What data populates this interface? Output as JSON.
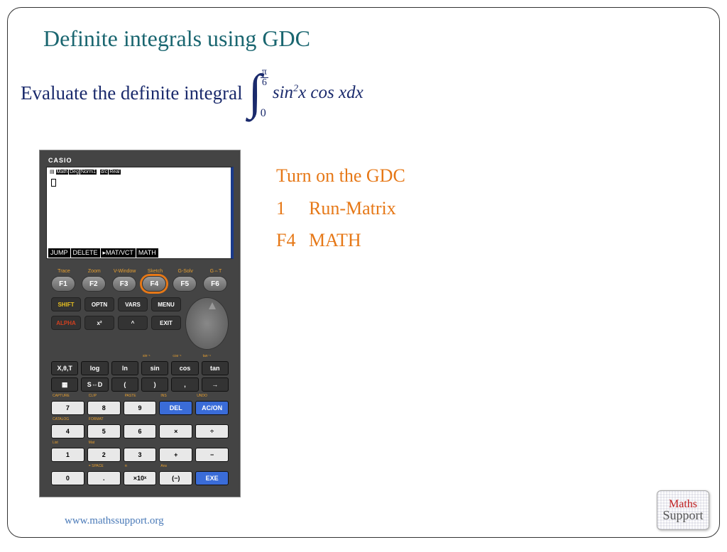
{
  "title": "Definite integrals using GDC",
  "problem_text": "Evaluate the definite integral",
  "integral": {
    "upper_num": "π",
    "upper_den": "6",
    "lower": "0",
    "body": "sin",
    "exp": "2",
    "body2": "x cos xdx"
  },
  "calc": {
    "brand": "CASIO",
    "screen_tags": [
      "Math",
      "Deg",
      "Norm1",
      "d/c",
      "Real"
    ],
    "screen_menu": [
      "JUMP",
      "DELETE",
      "▸MAT/VCT",
      "MATH"
    ],
    "f_labels": [
      "Trace",
      "Zoom",
      "V-Window",
      "Sketch",
      "G-Solv",
      "G⇔T"
    ],
    "f_keys": [
      "F1",
      "F2",
      "F3",
      "F4",
      "F5",
      "F6"
    ],
    "shift": "SHIFT",
    "optn": "OPTN",
    "vars": "VARS",
    "menu": "MENU",
    "alpha": "ALPHA",
    "x2": "x²",
    "pow": "^",
    "exit": "EXIT",
    "r1": [
      "X,θ,T",
      "log",
      "ln",
      "sin",
      "cos",
      "tan"
    ],
    "r2": [
      "▦",
      "S⇔D",
      "(",
      ")",
      ",",
      "→"
    ],
    "n1": [
      "7",
      "8",
      "9"
    ],
    "del": "DEL",
    "ac": "AC/ON",
    "n2": [
      "4",
      "5",
      "6",
      "×",
      "÷"
    ],
    "n3": [
      "1",
      "2",
      "3",
      "+",
      "−"
    ],
    "n4": [
      "0",
      ".",
      "×10ˣ",
      "(−)"
    ],
    "exe": "EXE"
  },
  "steps": {
    "title": "Turn on the GDC",
    "s1_num": "1",
    "s1": "Run-Matrix",
    "s2_num": "F4",
    "s2": "MATH"
  },
  "footer": "www.mathssupport.org",
  "logo": {
    "l1": "Maths",
    "l2": "Support"
  }
}
